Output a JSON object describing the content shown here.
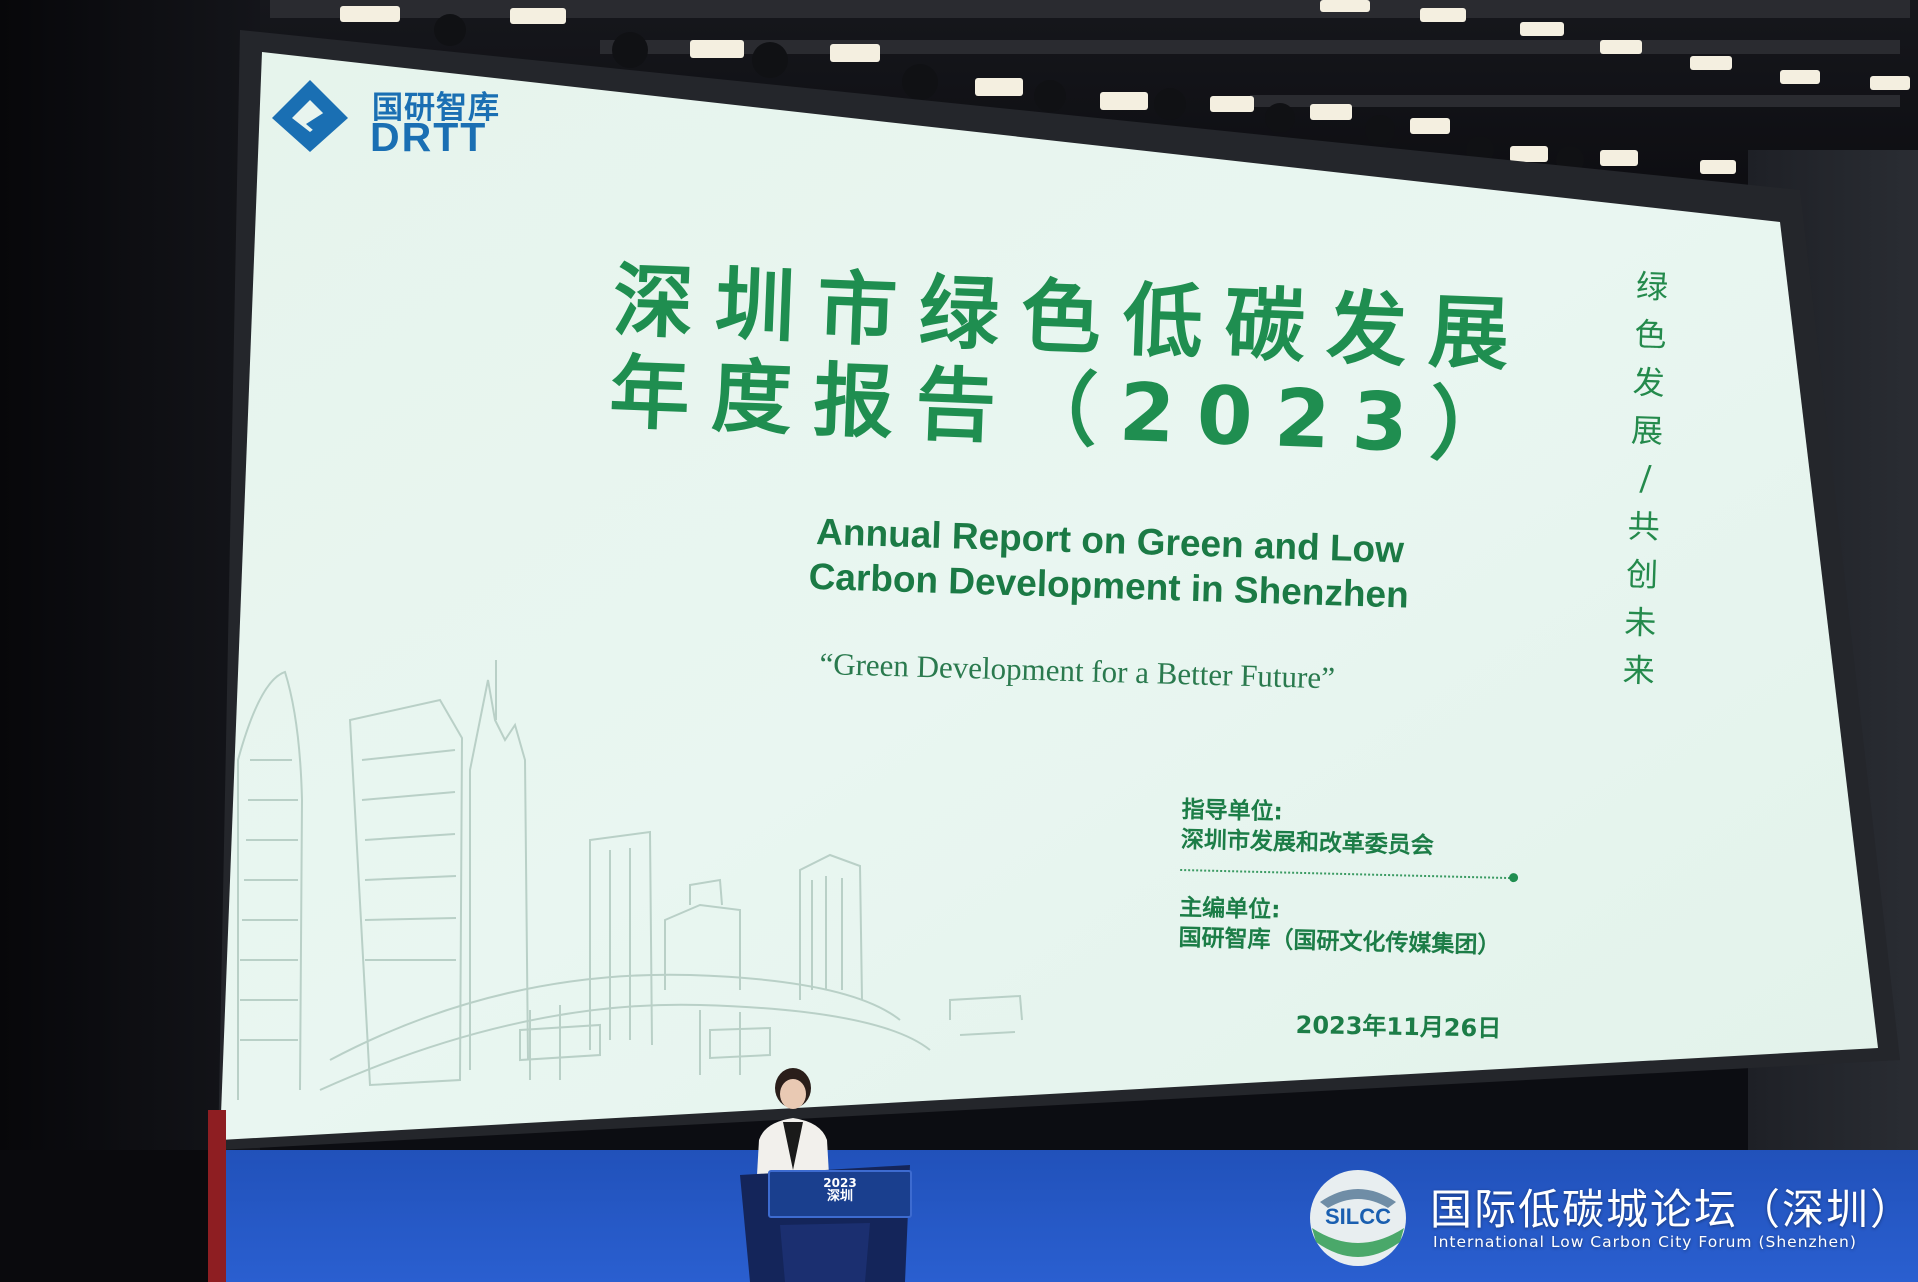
{
  "slide": {
    "logo_cn": "国研智库",
    "logo_en": "DRTT",
    "title_line1": "深圳市绿色低碳发展",
    "title_line2": "年度报告（2023）",
    "subtitle_line1": "Annual Report on Green and Low",
    "subtitle_line2": "Carbon Development in Shenzhen",
    "slogan": "“Green Development for a Better Future”",
    "vertical_text_1": [
      "绿",
      "色",
      "发",
      "展"
    ],
    "vertical_separator": "/",
    "vertical_text_2": [
      "共",
      "创",
      "未",
      "来"
    ],
    "guiding_label": "指导单位:",
    "guiding_value": "深圳市发展和改革委员会",
    "editor_label": "主编单位:",
    "editor_value": "国研智库（国研文化传媒集团）",
    "date": "2023年11月26日",
    "accent_color": "#1f8e50"
  },
  "podium": {
    "sign_year": "2023",
    "sign_text": "深圳"
  },
  "forum": {
    "logo_text": "SILCC",
    "name_cn": "国际低碳城论坛（深圳）",
    "name_en": "International Low Carbon City Forum (Shenzhen)"
  }
}
